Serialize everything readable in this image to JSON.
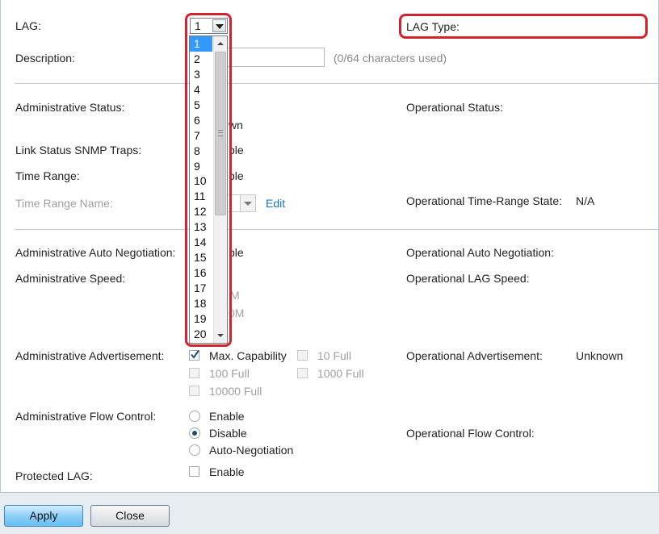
{
  "lag": {
    "label": "LAG:",
    "selected": "1",
    "options": [
      "1",
      "2",
      "3",
      "4",
      "5",
      "6",
      "7",
      "8",
      "9",
      "10",
      "11",
      "12",
      "13",
      "14",
      "15",
      "16",
      "17",
      "18",
      "19",
      "20"
    ]
  },
  "lag_type": {
    "label": "LAG Type:"
  },
  "description": {
    "label": "Description:",
    "hint": "(0/64 characters used)"
  },
  "admin_status": {
    "label": "Administrative Status:",
    "partial": "wn"
  },
  "oper_status": {
    "label": "Operational Status:"
  },
  "snmp_traps": {
    "label": "Link Status SNMP Traps:",
    "partial": "ble"
  },
  "time_range": {
    "label": "Time Range:",
    "partial": "ble"
  },
  "time_range_name": {
    "label": "Time Range Name:",
    "edit": "Edit"
  },
  "oper_time_range": {
    "label": "Operational Time-Range State:",
    "value": "N/A"
  },
  "admin_auto_neg": {
    "label": "Administrative Auto Negotiation:",
    "partial": "ble"
  },
  "oper_auto_neg": {
    "label": "Operational Auto Negotiation:"
  },
  "admin_speed": {
    "label": "Administrative Speed:",
    "partial1": "M",
    "partial2": "0M"
  },
  "oper_lag_speed": {
    "label": "Operational LAG Speed:"
  },
  "admin_adv": {
    "label": "Administrative Advertisement:",
    "options": [
      "Max. Capability",
      "10 Full",
      "100 Full",
      "1000 Full",
      "10000 Full"
    ]
  },
  "oper_adv": {
    "label": "Operational Advertisement:",
    "value": "Unknown"
  },
  "flow_control": {
    "label": "Administrative Flow Control:",
    "options": [
      "Enable",
      "Disable",
      "Auto-Negotiation"
    ],
    "selected": "Disable"
  },
  "oper_flow_control": {
    "label": "Operational Flow Control:"
  },
  "protected_lag": {
    "label": "Protected LAG:",
    "option": "Enable"
  },
  "buttons": {
    "apply": "Apply",
    "close": "Close"
  },
  "colors": {
    "highlight": "#d3232f",
    "selection": "#3399ff",
    "link": "#1a70b8"
  }
}
